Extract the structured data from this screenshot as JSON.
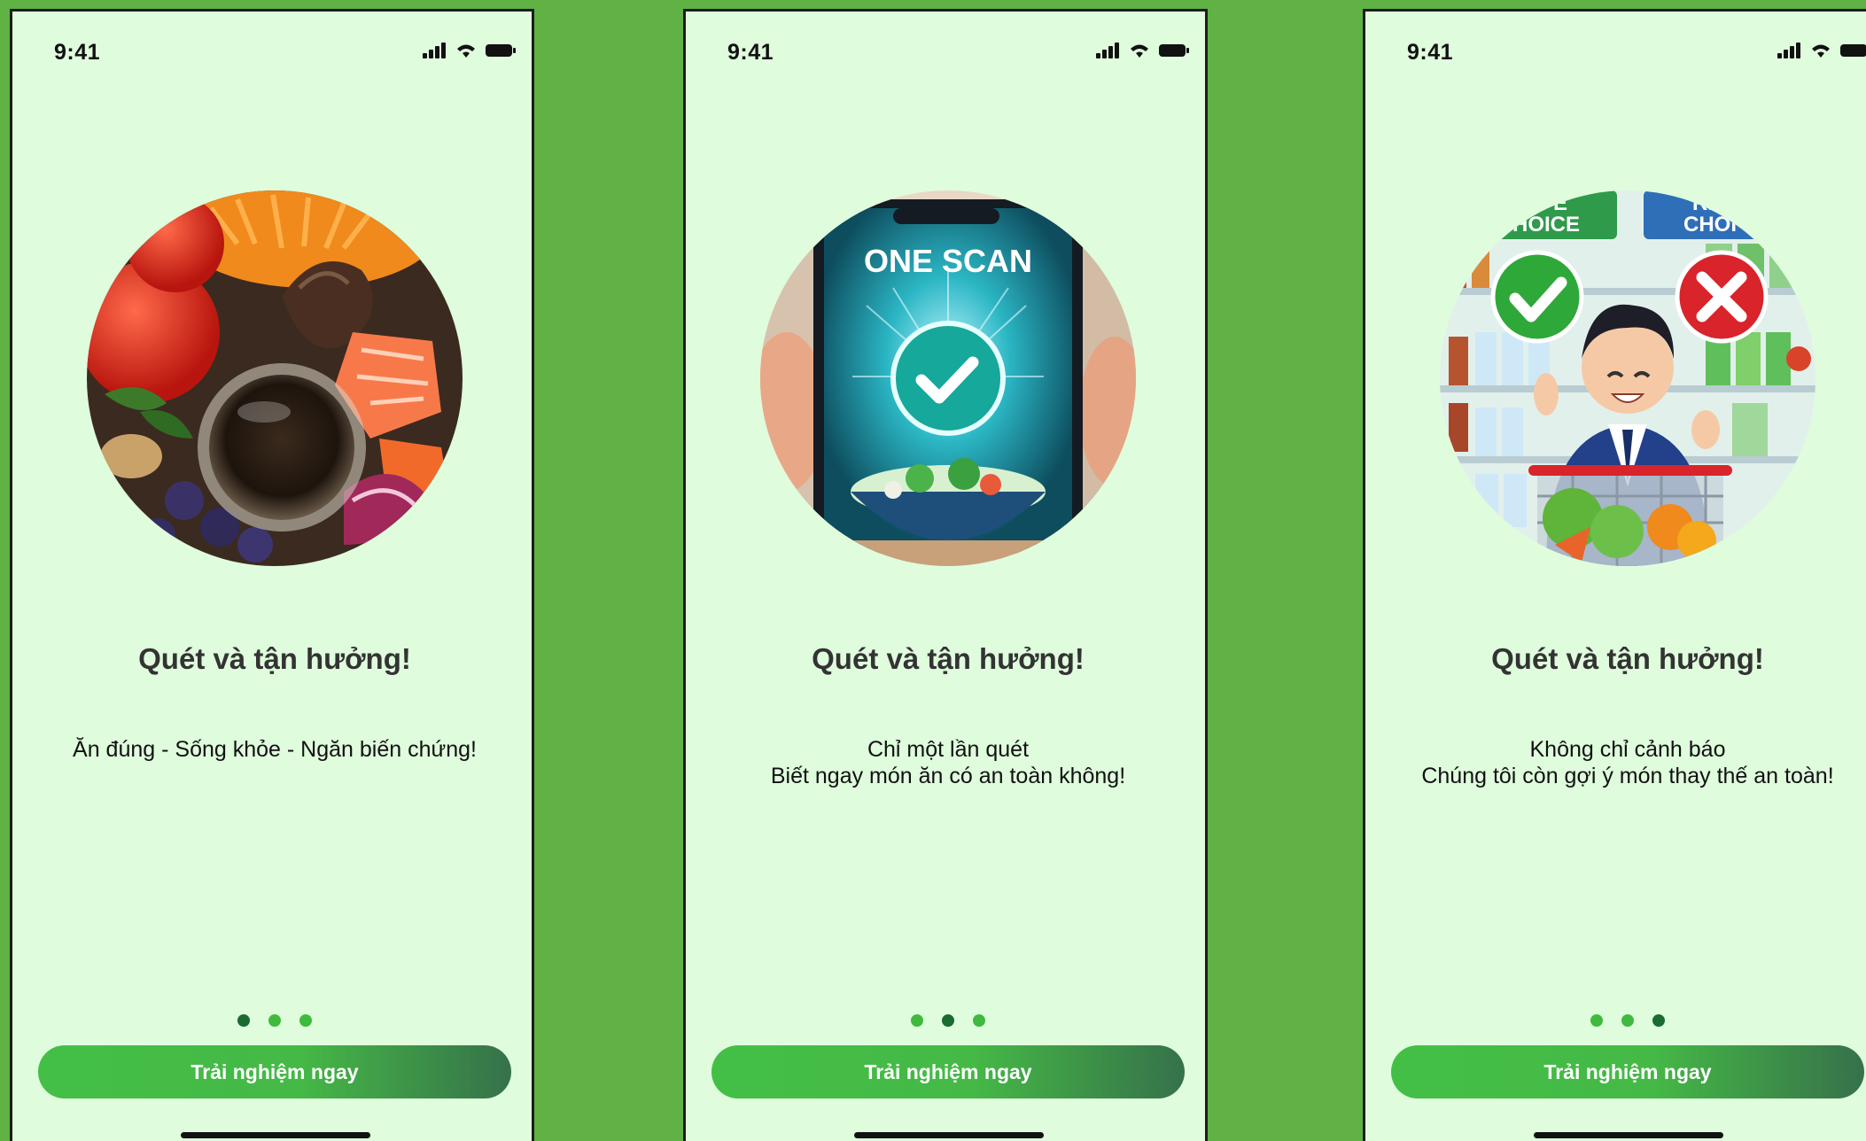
{
  "status_bar": {
    "time": "9:41"
  },
  "screens": [
    {
      "title": "Quét và tận hưởng!",
      "subtitle_lines": [
        "Ăn đúng - Sống khỏe - Ngăn biến chứng!"
      ],
      "active_dot": 0,
      "cta_label": "Trải nghiệm ngay"
    },
    {
      "title": "Quét và tận hưởng!",
      "subtitle_lines": [
        "Chỉ một lần quét",
        "Biết ngay món ăn có an toàn không!"
      ],
      "image_text": "ONE SCAN",
      "active_dot": 1,
      "cta_label": "Trải nghiệm ngay"
    },
    {
      "title": "Quét và tận hưởng!",
      "subtitle_lines": [
        "Không chỉ cảnh báo",
        "Chúng tôi còn gợi ý món thay thế an toàn!"
      ],
      "sign_texts": [
        "AFE",
        "HOICE",
        "RIS",
        "CHOI"
      ],
      "active_dot": 2,
      "cta_label": "Trải nghiệm ngay"
    }
  ],
  "colors": {
    "background": "#5fb243",
    "screen": "#dffcdd",
    "dot_active": "#1b6a31",
    "dot_inactive": "#3fba3e",
    "cta_start": "#43bf46",
    "cta_end": "#36714a"
  }
}
